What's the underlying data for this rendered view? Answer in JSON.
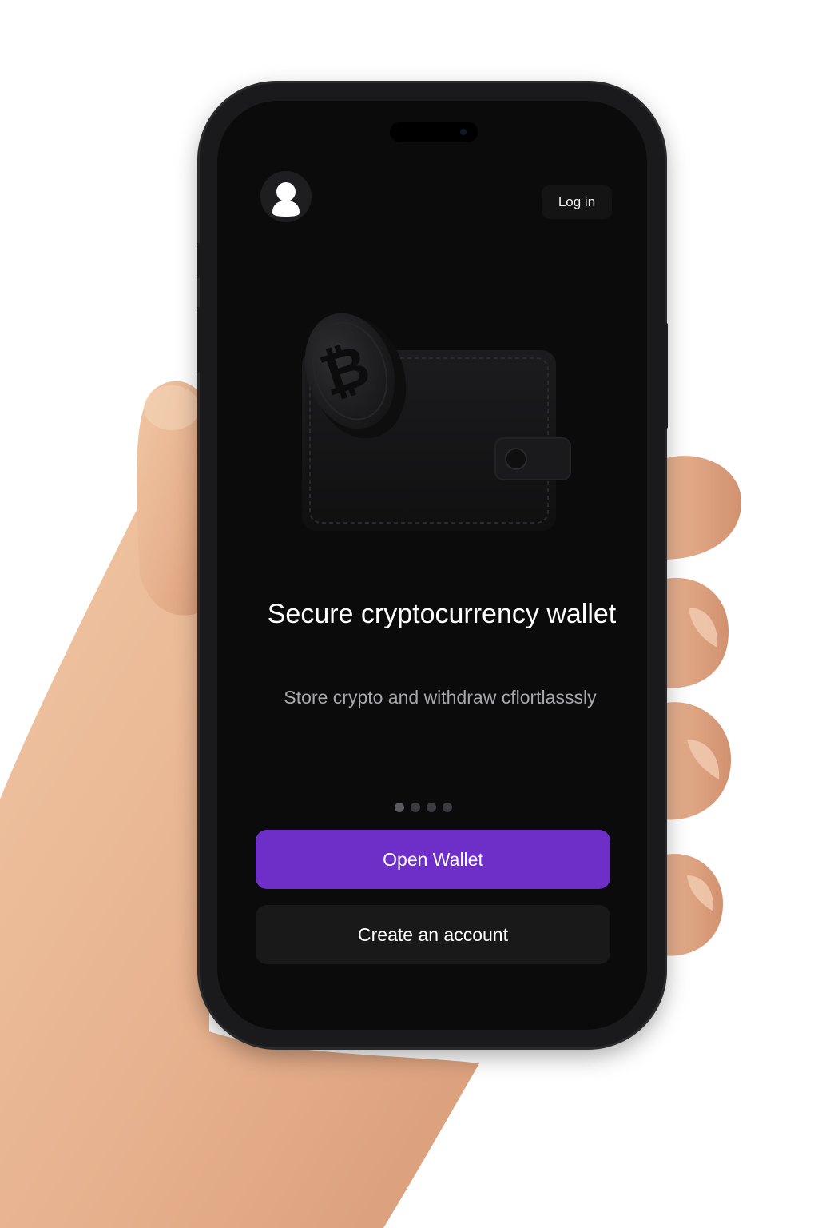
{
  "header": {
    "login_label": "Log in"
  },
  "hero": {
    "illustration": "wallet-with-bitcoin-coin",
    "coin_icon": "bitcoin-icon"
  },
  "main": {
    "title": "Secure cryptocurrency wallet",
    "subtitle": "Store crypto and withdraw cflortlasssly"
  },
  "pagination": {
    "total_pages": 4
  },
  "actions": {
    "primary_label": "Open Wallet",
    "secondary_label": "Create an account"
  },
  "colors": {
    "accent": "#6d2fc8",
    "screen_background": "#0b0b0c",
    "secondary_button": "#19191a"
  }
}
